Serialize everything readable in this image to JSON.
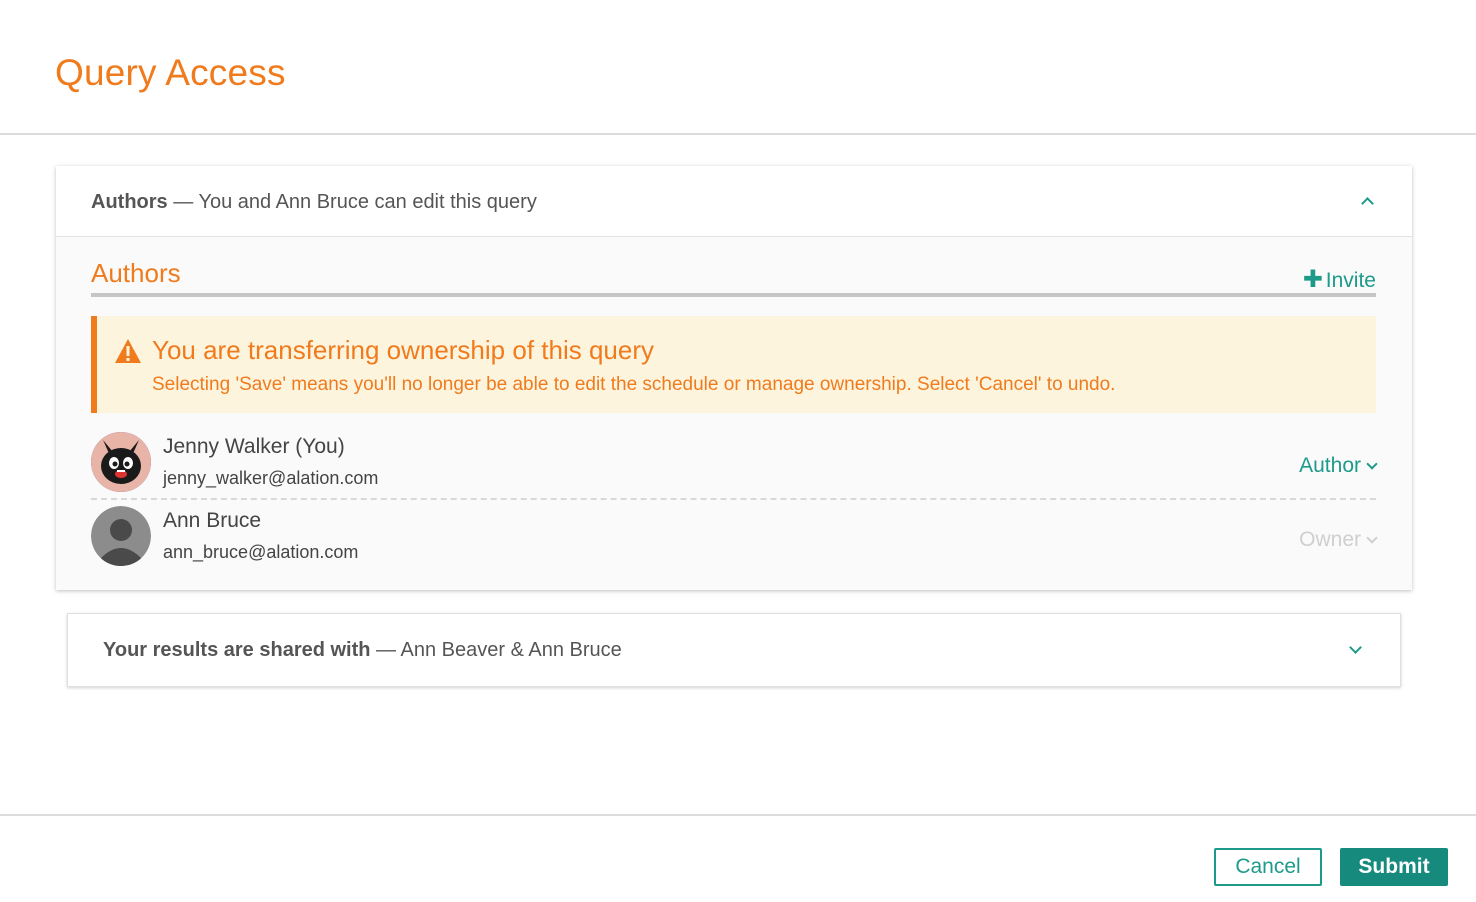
{
  "page": {
    "title": "Query Access"
  },
  "authors_panel": {
    "heading_bold": "Authors",
    "heading_sep": " — ",
    "heading_text": "You and Ann Bruce can edit this query",
    "section_title": "Authors",
    "invite_label": "Invite",
    "invite_icon": "plus-icon",
    "collapse_icon": "chevron-up-icon"
  },
  "warning": {
    "icon": "warning-triangle-icon",
    "title": "You are transferring ownership of this query",
    "body": "Selecting 'Save' means you'll no longer be able to edit the schedule or manage ownership. Select 'Cancel' to undo.",
    "color": "#f07b1d",
    "background": "#fdf4de"
  },
  "members": [
    {
      "name": "Jenny Walker (You)",
      "email": "jenny_walker@alation.com",
      "role": "Author",
      "role_enabled": true,
      "avatar": "black-cat-avatar"
    },
    {
      "name": "Ann Bruce",
      "email": "ann_bruce@alation.com",
      "role": "Owner",
      "role_enabled": false,
      "avatar": "default-user-avatar"
    }
  ],
  "shared_panel": {
    "heading_bold": "Your results are shared with",
    "heading_sep": " — ",
    "heading_text": "Ann Beaver & Ann Bruce",
    "expand_icon": "chevron-down-icon"
  },
  "footer": {
    "cancel_label": "Cancel",
    "submit_label": "Submit"
  },
  "colors": {
    "accent": "#f07b1d",
    "primary": "#1e9a8a",
    "submit_bg": "#168a7c"
  }
}
